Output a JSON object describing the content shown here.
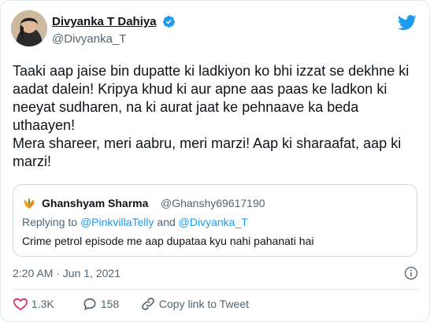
{
  "author": {
    "display_name": "Divyanka T Dahiya",
    "handle": "@Divyanka_T"
  },
  "tweet": {
    "paragraphs": [
      "Taaki aap jaise bin dupatte ki ladkiyon ko bhi izzat se dekhne ki aadat dalein! Kripya khud ki aur apne aas paas ke ladkon ki neeyat sudharen, na ki aurat jaat ke pehnaave ka beda uthaayen!",
      "Mera shareer, meri aabru, meri marzi! Aap ki sharaafat, aap ki marzi!"
    ]
  },
  "quoted": {
    "display_name": "Ghanshyam Sharma",
    "handle": "@Ghanshy69617190",
    "replying_prefix": "Replying to ",
    "reply_handle_1": "@PinkvillaTelly",
    "reply_and": " and ",
    "reply_handle_2": "@Divyanka_T",
    "text": "Crime petrol episode me aap dupataa kyu nahi pahanati hai"
  },
  "meta": {
    "timestamp": "2:20 AM · Jun 1, 2021"
  },
  "actions": {
    "likes": "1.3K",
    "replies": "158",
    "copy_link_label": "Copy link to Tweet"
  },
  "colors": {
    "accent": "#1d9bf0",
    "like_red": "#e0245e",
    "secondary_text": "#536471"
  }
}
